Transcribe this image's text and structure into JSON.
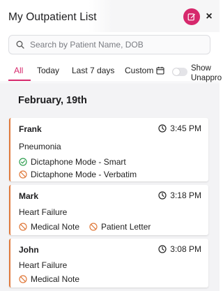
{
  "header": {
    "title": "My Outpatient List"
  },
  "search": {
    "placeholder": "Search by Patient Name, DOB"
  },
  "tabs": [
    {
      "label": "All",
      "active": true
    },
    {
      "label": "Today",
      "active": false
    },
    {
      "label": "Last 7 days",
      "active": false
    },
    {
      "label": "Custom",
      "active": false
    }
  ],
  "toggle": {
    "label_line1": "Show",
    "label_line2": "Unappro",
    "on": false
  },
  "list": {
    "date_heading": "February, 19th",
    "cards": [
      {
        "name": "Frank",
        "time": "3:45 PM",
        "diagnosis": "Pneumonia",
        "documents": [
          {
            "label": "Dictaphone Mode - Smart",
            "status": "complete"
          },
          {
            "label": "Dictaphone Mode - Verbatim",
            "status": "not-started"
          }
        ]
      },
      {
        "name": "Mark",
        "time": "3:18 PM",
        "diagnosis": "Heart Failure",
        "documents": [
          {
            "label": "Medical Note",
            "status": "not-started"
          },
          {
            "label": "Patient Letter",
            "status": "not-started"
          }
        ]
      },
      {
        "name": "John",
        "time": "3:08 PM",
        "diagnosis": "Heart Failure",
        "documents": [
          {
            "label": "Medical Note",
            "status": "not-started"
          }
        ]
      }
    ]
  },
  "colors": {
    "accent": "#d6286c",
    "card_border": "#e07a3c",
    "complete_icon": "#2e9e4f",
    "not_started_icon": "#e07a3c"
  }
}
